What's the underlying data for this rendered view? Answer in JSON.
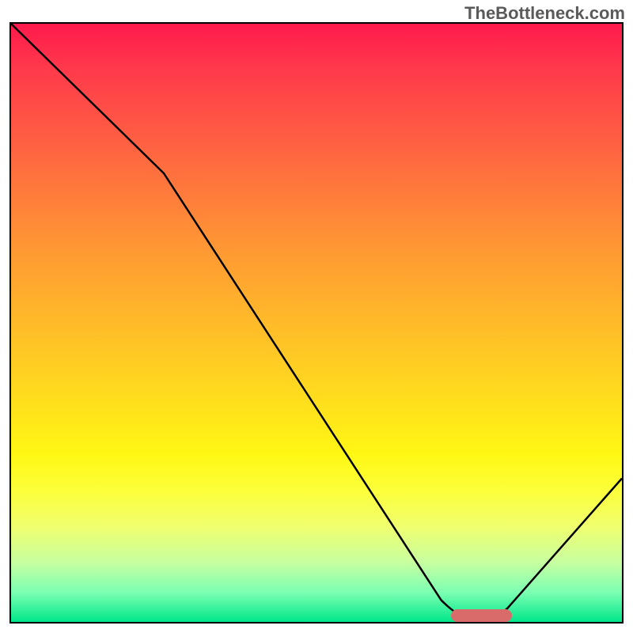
{
  "watermark": "TheBottleneck.com",
  "chart_data": {
    "type": "line",
    "title": "",
    "xlabel": "",
    "ylabel": "",
    "xlim": [
      0,
      100
    ],
    "ylim": [
      0,
      100
    ],
    "series": [
      {
        "name": "curve",
        "x": [
          0,
          25,
          73,
          80,
          100
        ],
        "values": [
          100,
          75,
          1,
          1,
          24
        ]
      }
    ],
    "valley_marker": {
      "x_start": 72,
      "x_end": 82,
      "y": 1
    },
    "gradient": {
      "top_color": "#ff1a4d",
      "bottom_color": "#00e68a"
    }
  }
}
